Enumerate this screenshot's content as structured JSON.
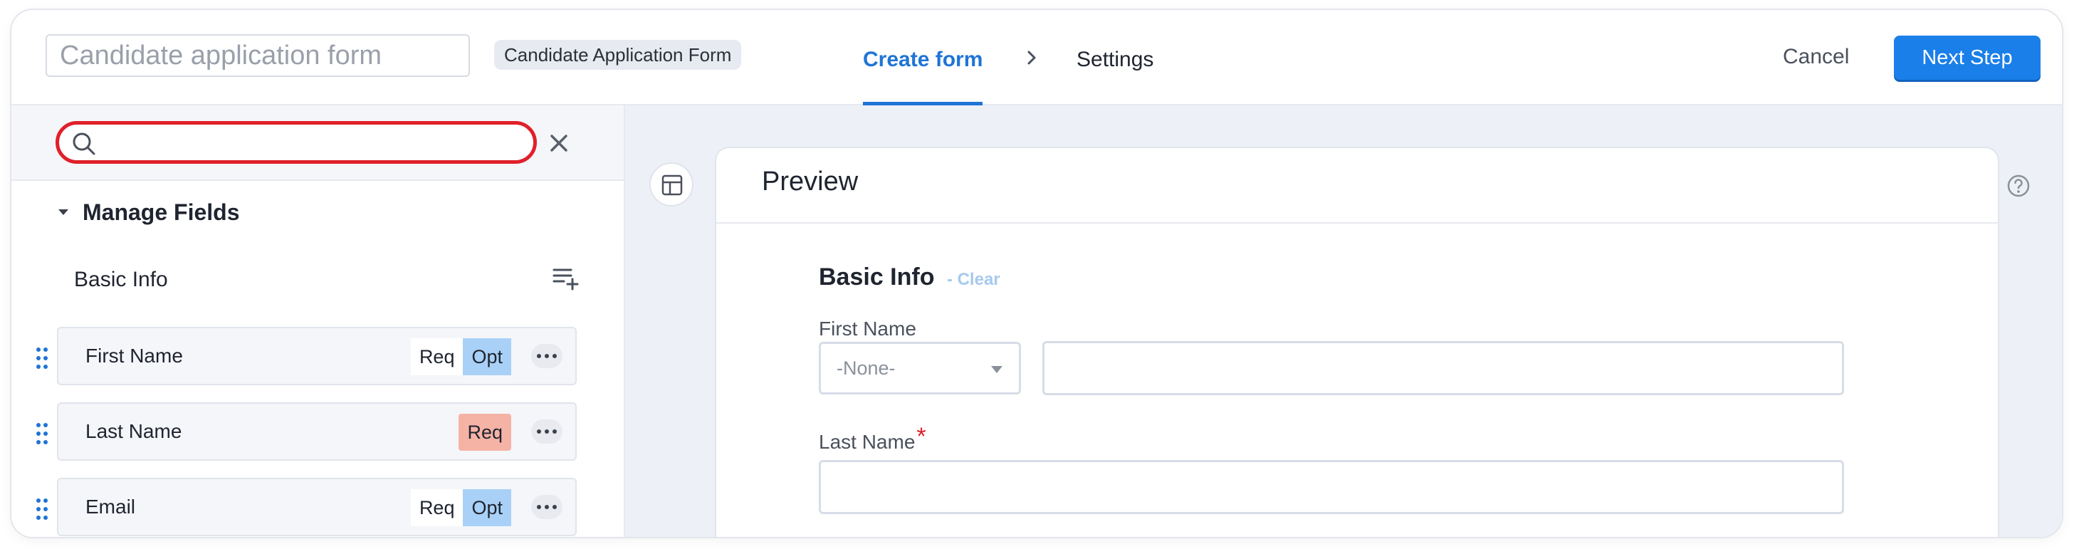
{
  "header": {
    "form_name_placeholder": "Candidate application form",
    "form_chip": "Candidate Application Form",
    "steps": [
      {
        "label": "Create form",
        "active": true
      },
      {
        "label": "Settings",
        "active": false
      }
    ],
    "cancel_label": "Cancel",
    "next_label": "Next Step"
  },
  "sidebar": {
    "search": {
      "value": "",
      "placeholder": ""
    },
    "manage_fields_label": "Manage Fields",
    "section_label": "Basic Info",
    "fields": [
      {
        "name": "First Name",
        "req_label": "Req",
        "opt_label": "Opt",
        "state": "optional",
        "mandatory": false
      },
      {
        "name": "Last Name",
        "req_label": "Req",
        "state": "required",
        "mandatory": true
      },
      {
        "name": "Email",
        "req_label": "Req",
        "opt_label": "Opt",
        "state": "optional",
        "mandatory": false
      }
    ]
  },
  "preview": {
    "title": "Preview",
    "section_title": "Basic Info",
    "clear_label": "- Clear",
    "first_name_label": "First Name",
    "salutation_value": "-None-",
    "last_name_label": "Last Name",
    "required_mark": "*"
  },
  "colors": {
    "accent": "#1f74d6",
    "primary_button": "#1a7fe8",
    "search_highlight": "#e0202a",
    "opt_selected": "#a9d1f7",
    "req_selected": "#f5b3a6",
    "drag_handle": "#1f74d6"
  },
  "icons": {
    "search": "search-icon",
    "clear_search": "close-icon",
    "step_separator": "chevron-right-icon",
    "collapse": "caret-down-icon",
    "add_section": "add-list-icon",
    "drag": "drag-handle-icon",
    "more": "more-horizontal-icon",
    "layout": "layout-icon",
    "help": "help-circle-icon",
    "select": "chevron-down-icon"
  }
}
